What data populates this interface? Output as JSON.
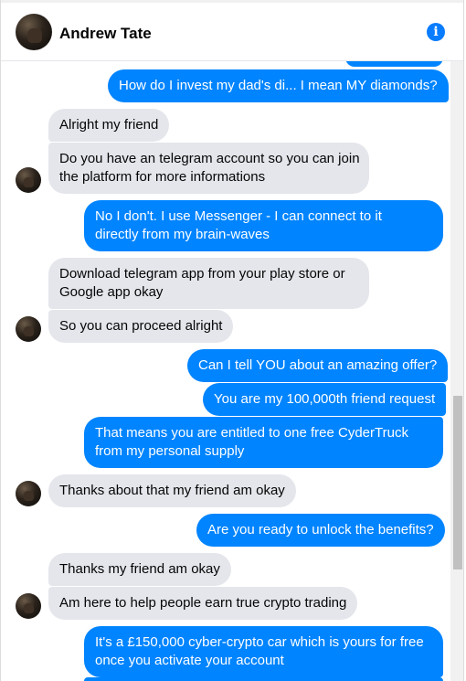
{
  "header": {
    "contact_name": "Andrew Tate",
    "info_icon": "i"
  },
  "messages": [
    {
      "id": "m1",
      "direction": "outgoing",
      "text": "How do I invest my dad's di... I mean MY diamonds?"
    },
    {
      "id": "m2",
      "direction": "incoming",
      "text": "Alright my friend"
    },
    {
      "id": "m3",
      "direction": "incoming",
      "line1": "Do you have an telegram account so you can join",
      "line2": "the platform for more informations"
    },
    {
      "id": "m4",
      "direction": "outgoing",
      "line1": "No I don't. I use Messenger -  I can connect to it",
      "line2": "directly from my brain-waves"
    },
    {
      "id": "m5",
      "direction": "incoming",
      "line1": "Download telegram app from your play store or",
      "line2": "Google app okay"
    },
    {
      "id": "m6",
      "direction": "incoming",
      "text": "So you can proceed alright"
    },
    {
      "id": "m7",
      "direction": "outgoing",
      "text": "Can I tell YOU about an amazing offer?"
    },
    {
      "id": "m8",
      "direction": "outgoing",
      "text": "You are my 100,000th friend request"
    },
    {
      "id": "m9",
      "direction": "outgoing",
      "line1": "That means you are entitled to one free CyderTruck",
      "line2": "from my personal supply"
    },
    {
      "id": "m10",
      "direction": "incoming",
      "text": "Thanks about that my friend am okay"
    },
    {
      "id": "m11",
      "direction": "outgoing",
      "text": "Are you ready to unlock the benefits?"
    },
    {
      "id": "m12",
      "direction": "incoming",
      "text": "Thanks my friend am okay"
    },
    {
      "id": "m13",
      "direction": "incoming",
      "text": "Am here to help people earn true crypto trading"
    },
    {
      "id": "m14",
      "direction": "outgoing",
      "line1": "It's a £150,000 cyber-crypto car which is yours for free",
      "line2": "once you activate your account"
    }
  ],
  "colors": {
    "outgoing_bubble": "#0084ff",
    "incoming_bubble": "#e4e6eb",
    "accent": "#0a7cff"
  }
}
